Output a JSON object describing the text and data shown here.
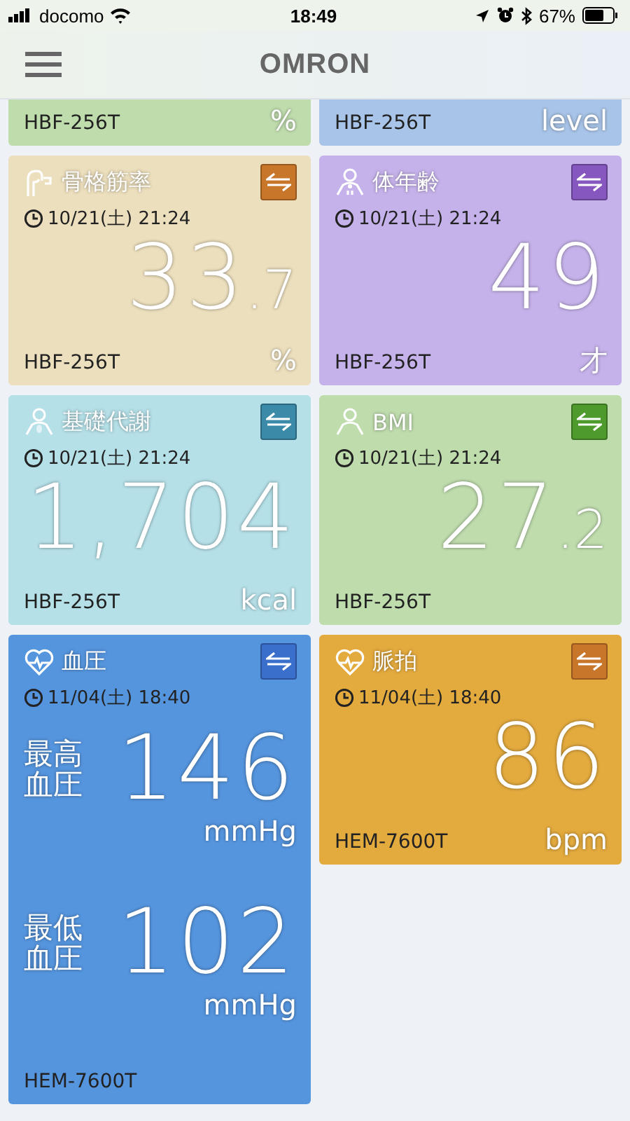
{
  "status_bar": {
    "carrier": "docomo",
    "time": "18:49",
    "battery": "67%"
  },
  "header": {
    "logo": "OMRON"
  },
  "cards": [
    {
      "kind": "partial",
      "color": "#bfdcad",
      "device": "HBF-256T",
      "unit": "%"
    },
    {
      "kind": "partial",
      "color": "#a8c4e8",
      "device": "HBF-256T",
      "unit": "level"
    },
    {
      "kind": "skeletal-muscle",
      "color": "#ecdfbd",
      "title": "骨格筋率",
      "date": "10/21(土) 21:24",
      "value": "33",
      "decimal": ".7",
      "device": "HBF-256T",
      "unit": "%"
    },
    {
      "kind": "body-age",
      "color": "#c5b2ea",
      "title": "体年齢",
      "date": "10/21(土) 21:24",
      "value": "49",
      "device": "HBF-256T",
      "unit": "才"
    },
    {
      "kind": "basal-metabolism",
      "color": "#b5e0e8",
      "title": "基礎代謝",
      "date": "10/21(土) 21:24",
      "value": "1,704",
      "device": "HBF-256T",
      "unit": "kcal"
    },
    {
      "kind": "bmi",
      "color": "#bfdcad",
      "title": "BMI",
      "date": "10/21(土) 21:24",
      "value": "27",
      "decimal": ".2",
      "device": "HBF-256T"
    },
    {
      "kind": "blood-pressure",
      "color": "#5595de",
      "title": "血圧",
      "date": "11/04(土) 18:40",
      "readings": [
        {
          "label": "最高血圧",
          "value": "146",
          "unit": "mmHg"
        },
        {
          "label": "最低血圧",
          "value": "102",
          "unit": "mmHg"
        }
      ],
      "device": "HEM-7600T"
    },
    {
      "kind": "pulse",
      "color": "#e3aa3e",
      "title": "脈拍",
      "date": "11/04(土) 18:40",
      "value": "86",
      "device": "HEM-7600T",
      "unit": "bpm"
    }
  ]
}
